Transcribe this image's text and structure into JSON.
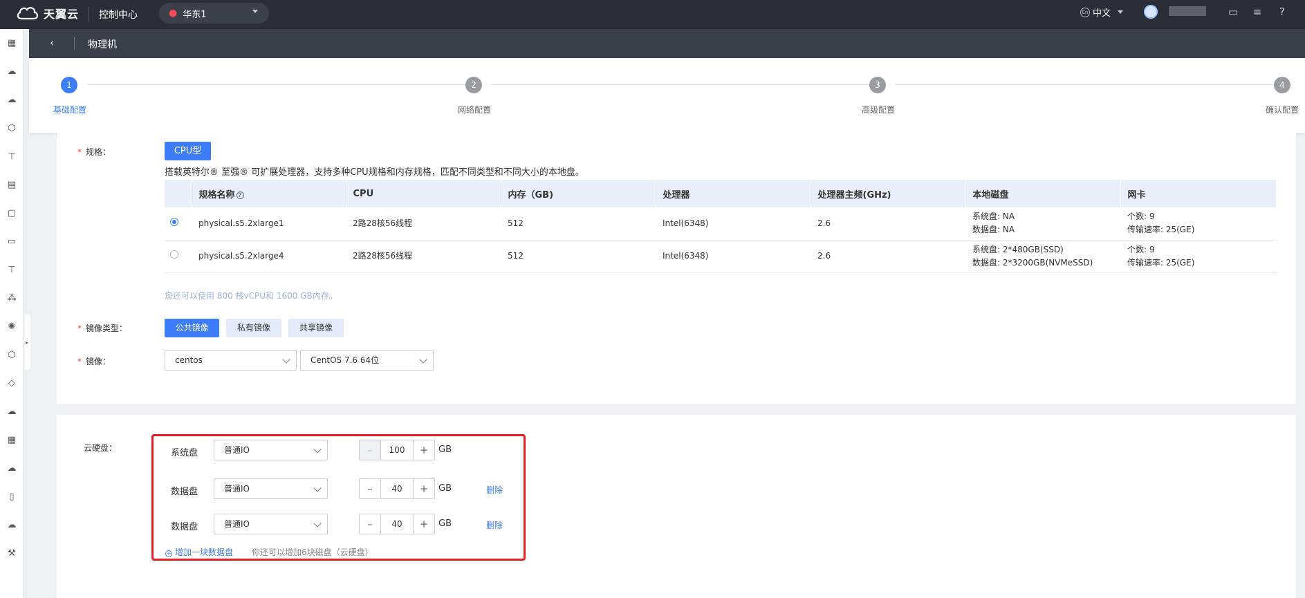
{
  "topbar": {
    "brand": "天翼云",
    "console": "控制中心",
    "region": "华东1",
    "language": "中文",
    "icons": [
      "message-icon",
      "settings-sliders-icon",
      "help-icon"
    ]
  },
  "rail": {
    "icons": [
      "grid-icon",
      "cloud-icon",
      "cloud-server-icon",
      "cube-icon",
      "tshirt-icon",
      "chart-icon",
      "chat-icon",
      "card-icon",
      "tshirt-icon-2",
      "cluster-icon",
      "gear-icon",
      "hexagon-icon",
      "box-icon",
      "cloud-icon-2",
      "qr-icon",
      "cloud-active-icon",
      "phone-icon",
      "cloud-eye-icon",
      "tool-icon"
    ]
  },
  "header": {
    "back_icon": "chevron-left-icon",
    "title": "物理机"
  },
  "steps": [
    {
      "num": "1",
      "label": "基础配置",
      "active": true
    },
    {
      "num": "2",
      "label": "网络配置",
      "active": false
    },
    {
      "num": "3",
      "label": "高级配置",
      "active": false
    },
    {
      "num": "4",
      "label": "确认配置",
      "active": false
    }
  ],
  "spec": {
    "label": "规格：",
    "type_button": "CPU型",
    "description": "搭载英特尔® 至强® 可扩展处理器，支持多种CPU规格和内存规格，匹配不同类型和不同大小的本地盘。",
    "columns": [
      "规格名称",
      "CPU",
      "内存（GB)",
      "处理器",
      "处理器主频(GHz)",
      "本地磁盘",
      "网卡"
    ],
    "rows": [
      {
        "selected": true,
        "name": "physical.s5.2xlarge1",
        "cpu": "2路28核56线程",
        "memory": "512",
        "processor": "Intel(6348)",
        "freq": "2.6",
        "disk1": "系统盘: NA",
        "disk2": "数据盘: NA",
        "nic1": "个数: 9",
        "nic2": "传输速率: 25(GE)"
      },
      {
        "selected": false,
        "name": "physical.s5.2xlarge4",
        "cpu": "2路28核56线程",
        "memory": "512",
        "processor": "Intel(6348)",
        "freq": "2.6",
        "disk1": "系统盘: 2*480GB(SSD)",
        "disk2": "数据盘: 2*3200GB(NVMeSSD)",
        "nic1": "个数: 9",
        "nic2": "传输速率: 25(GE)"
      }
    ],
    "quota_hint": "您还可以使用 800 核vCPU和 1600 GB内存。"
  },
  "image_type": {
    "label": "镜像类型：",
    "options": [
      "公共镜像",
      "私有镜像",
      "共享镜像"
    ],
    "selected": "公共镜像"
  },
  "image": {
    "label": "镜像：",
    "os": "centos",
    "version": "CentOS 7.6 64位"
  },
  "disk": {
    "label": "云硬盘：",
    "rows": [
      {
        "name": "系统盘",
        "type": "普通IO",
        "size": "100",
        "unit": "GB",
        "delete": ""
      },
      {
        "name": "数据盘",
        "type": "普通IO",
        "size": "40",
        "unit": "GB",
        "delete": "删除"
      },
      {
        "name": "数据盘",
        "type": "普通IO",
        "size": "40",
        "unit": "GB",
        "delete": "删除"
      }
    ],
    "add_link": "增加一块数据盘",
    "add_note": "你还可以增加6块磁盘（云硬盘）",
    "minus": "–",
    "plus": "+"
  },
  "colors": {
    "accent": "#3d7dfa",
    "topbar": "#2b2e37",
    "highlight": "#e81c24"
  }
}
